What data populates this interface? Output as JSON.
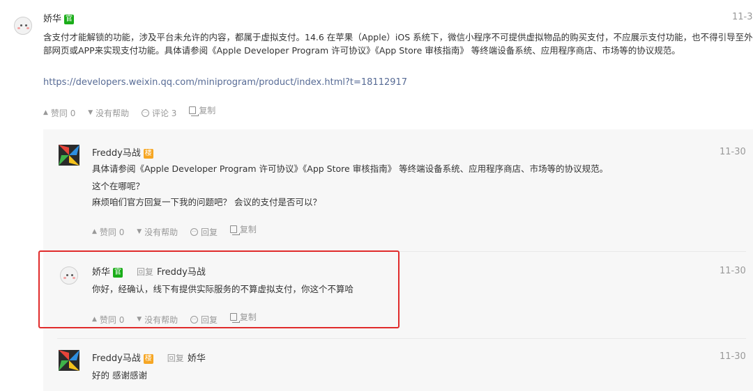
{
  "main_comment": {
    "author": "娇华",
    "badge": "官",
    "time": "11-3",
    "text": "含支付才能解锁的功能，涉及平台未允许的内容，都属于虚拟支付。14.6 在苹果（Apple）iOS 系统下，微信小程序不可提供虚拟物品的购买支付，不应展示支付功能，也不得引导至外部网页或APP来实现支付功能。具体请参阅《Apple Developer Program 许可协议》《App Store 审核指南》 等终端设备系统、应用程序商店、市场等的协议规范。",
    "link": "https://developers.weixin.qq.com/miniprogram/product/index.html?t=18112917",
    "like": "赞同 0",
    "unhelpful": "没有帮助",
    "comment": "评论 3",
    "copy": "复制"
  },
  "replies": [
    {
      "author": "Freddy马战",
      "badge": "楼",
      "time": "11-30",
      "lines": [
        "具体请参阅《Apple Developer Program 许可协议》《App Store 审核指南》 等终端设备系统、应用程序商店、市场等的协议规范。",
        "这个在哪呢？",
        "麻烦咱们官方回复一下我的问题吧？ 会议的支付是否可以？"
      ],
      "like": "赞同 0",
      "unhelpful": "没有帮助",
      "reply": "回复",
      "copy": "复制"
    },
    {
      "author": "娇华",
      "badge": "官",
      "reply_tag": "回复",
      "reply_target": "Freddy马战",
      "time": "11-30",
      "lines": [
        "你好，经确认，线下有提供实际服务的不算虚拟支付，你这个不算哈"
      ],
      "like": "赞同 0",
      "unhelpful": "没有帮助",
      "reply": "回复",
      "copy": "复制"
    },
    {
      "author": "Freddy马战",
      "badge": "楼",
      "reply_tag": "回复",
      "reply_target": "娇华",
      "time": "11-30",
      "lines": [
        "好的 感谢感谢"
      ]
    }
  ],
  "colors": {
    "official_badge": "#1aad19",
    "author_badge": "#f6a623",
    "link": "#576b95",
    "highlight_border": "#e02b2b"
  }
}
